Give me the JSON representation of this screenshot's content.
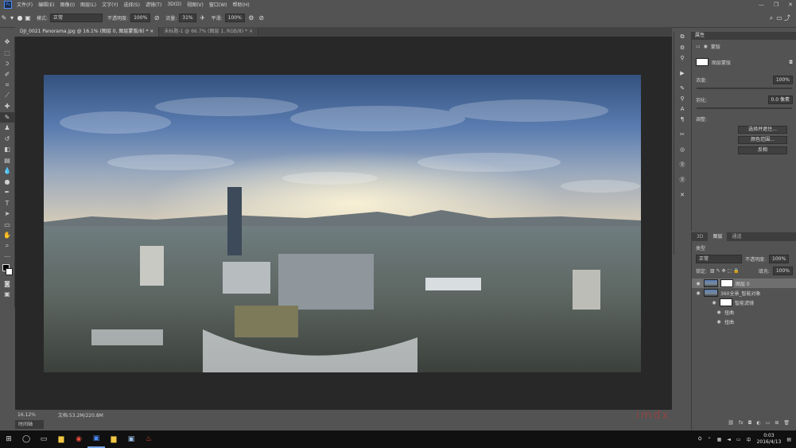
{
  "app": {
    "logo": "Ps"
  },
  "menu": [
    "文件(F)",
    "编辑(E)",
    "图像(I)",
    "图层(L)",
    "文字(Y)",
    "选择(S)",
    "滤镜(T)",
    "3D(D)",
    "视图(V)",
    "窗口(W)",
    "帮助(H)"
  ],
  "options": {
    "mode_label": "模式:",
    "mode_value": "正常",
    "opacity_label": "不透明度:",
    "opacity_value": "100%",
    "flow_label": "流量:",
    "flow_value": "31%",
    "smooth_label": "平滑:",
    "smooth_value": "100%"
  },
  "tabs": [
    {
      "label": "DJI_0021 Panorama.jpg @ 16.1% (图层 0, 图层蒙版/8) *",
      "close": "×"
    },
    {
      "label": "未标题-1 @ 66.7% (图层 1, RGB/8) *",
      "close": "×"
    }
  ],
  "status": {
    "zoom": "16.12%",
    "doc": "文档:53.2M/220.8M"
  },
  "bottom_tab": "时间轴",
  "properties": {
    "header": "属性",
    "sub": "蒙版",
    "mask_label": "图层蒙版",
    "density_label": "浓度:",
    "density_value": "100%",
    "feather_label": "羽化:",
    "feather_value": "0.0 像素",
    "adjust_label": "调整:",
    "btn_select": "选择并遮住...",
    "btn_color": "颜色范围...",
    "btn_invert": "反相"
  },
  "layers": {
    "tabs": [
      "3D",
      "图层",
      "通道"
    ],
    "kind_label": "类型",
    "blend": "正常",
    "opacity_label": "不透明度:",
    "opacity_value": "100%",
    "lock_label": "锁定:",
    "fill_label": "填充:",
    "fill_value": "100%",
    "items": [
      {
        "name": "图层 0",
        "selected": true
      },
      {
        "name": "360全景_智能对象",
        "selected": false
      },
      {
        "name": "智能滤镜",
        "selected": false
      },
      {
        "name": "扭曲",
        "selected": false
      },
      {
        "name": "扭曲",
        "selected": false
      }
    ]
  },
  "taskbar": {
    "time": "0:03",
    "date": "2016/4/13"
  },
  "watermark": "imdx"
}
